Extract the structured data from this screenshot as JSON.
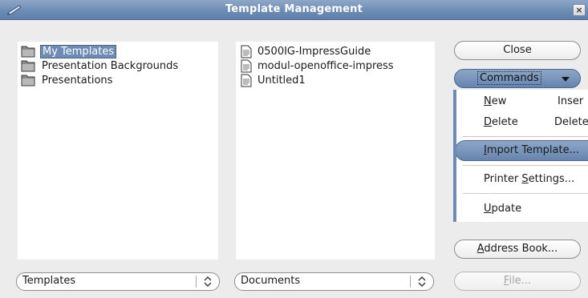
{
  "window": {
    "title": "Template Management",
    "close_glyph": "×"
  },
  "categories": {
    "items": [
      {
        "label": "My Templates",
        "selected": true
      },
      {
        "label": "Presentation Backgrounds",
        "selected": false
      },
      {
        "label": "Presentations",
        "selected": false
      }
    ],
    "selector_value": "Templates"
  },
  "templates": {
    "items": [
      {
        "label": "0500IG-ImpressGuide"
      },
      {
        "label": "modul-openoffice-impress"
      },
      {
        "label": "Untitled1"
      }
    ],
    "selector_value": "Documents"
  },
  "buttons": {
    "close": "Close",
    "commands": "Commands",
    "address_book_mnemonic": "A",
    "address_book_rest": "ddress Book...",
    "file_mnemonic": "F",
    "file_rest": "ile..."
  },
  "commands_menu": {
    "new_mnemonic": "N",
    "new_rest": "ew",
    "insert": "Inser",
    "delete_mnemonic": "D",
    "delete_rest": "elete",
    "delete_all": "Delete",
    "import_mnemonic": "I",
    "import_rest": "mport Template...",
    "printer_pre": "Printer ",
    "printer_mnemonic": "S",
    "printer_rest": "ettings...",
    "update_mnemonic": "U",
    "update_rest": "pdate"
  },
  "colors": {
    "titlebar": "#6d8cb5",
    "selection": "#6d8cb5",
    "window_bg": "#ececec"
  }
}
